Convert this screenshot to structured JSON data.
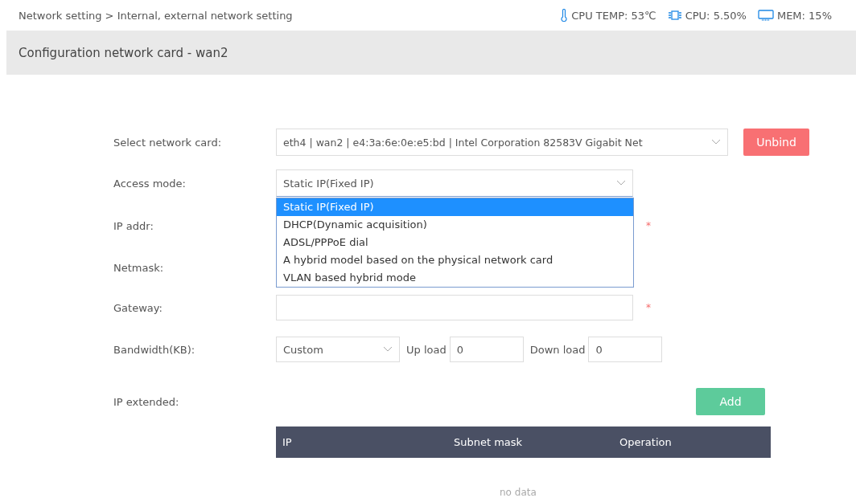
{
  "breadcrumb": "Network setting > Internal, external network setting",
  "status": [
    {
      "kind": "temp",
      "text": "CPU TEMP: 53℃"
    },
    {
      "kind": "cpu",
      "text": "CPU: 5.50%"
    },
    {
      "kind": "mem",
      "text": "MEM: 15%"
    }
  ],
  "panel_title": "Configuration network card - wan2",
  "network_card": {
    "label": "Select network card:",
    "value": "eth4 | wan2 | e4:3a:6e:0e:e5:bd | Intel Corporation 82583V Gigabit Net",
    "button": "Unbind"
  },
  "access_mode": {
    "label": "Access mode:",
    "value": "Static IP(Fixed IP)",
    "expanded": true,
    "options": [
      {
        "label": "Static IP(Fixed IP)",
        "selected": true
      },
      {
        "label": "DHCP(Dynamic acquisition)",
        "selected": false
      },
      {
        "label": "ADSL/PPPoE dial",
        "selected": false
      },
      {
        "label": "A hybrid model based on the physical network card",
        "selected": false
      },
      {
        "label": "VLAN based hybrid mode",
        "selected": false
      }
    ]
  },
  "ip_addr": {
    "label": "IP addr:",
    "required": "*"
  },
  "netmask": {
    "label": "Netmask:"
  },
  "gateway": {
    "label": "Gateway:",
    "required": "*"
  },
  "bandwidth": {
    "label": "Bandwidth(KB):",
    "mode": "Custom",
    "up_label": "Up load",
    "up_value": "0",
    "down_label": "Down load",
    "down_value": "0"
  },
  "ip_extended": {
    "label": "IP extended:",
    "button": "Add",
    "columns": [
      "IP",
      "Subnet mask",
      "Operation"
    ],
    "empty_text": "no data"
  }
}
